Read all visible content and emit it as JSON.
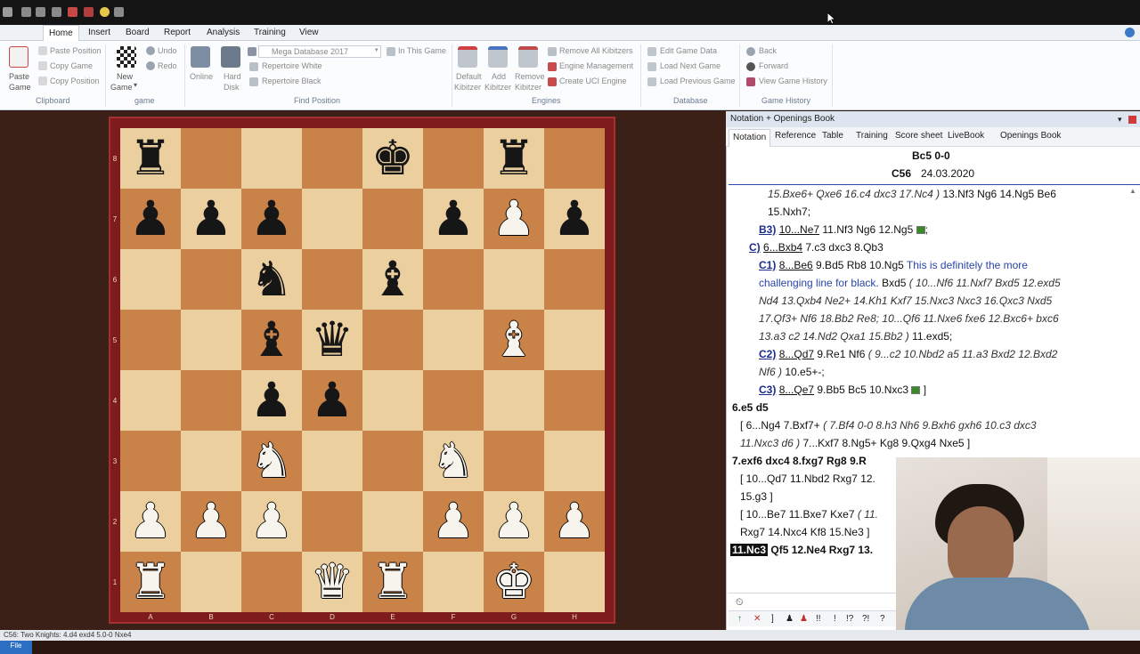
{
  "ribbon": {
    "tabs": [
      "File",
      "Home",
      "Insert",
      "Board",
      "Report",
      "Analysis",
      "Training",
      "View"
    ],
    "active_tab": "Home",
    "clipboard": {
      "paste_game": "Paste\nGame",
      "paste_game_1": "Paste",
      "paste_game_2": "Game",
      "paste_position": "Paste Position",
      "copy_game": "Copy Game",
      "copy_position": "Copy Position",
      "group": "Clipboard"
    },
    "game": {
      "new_game_1": "New",
      "new_game_2": "Game",
      "undo": "Undo",
      "redo": "Redo",
      "group": "game"
    },
    "find_position": {
      "online": "Online",
      "hard_disk_1": "Hard",
      "hard_disk_2": "Disk",
      "database": "Mega Database 2017",
      "in_this_game": "In This Game",
      "repertoire_white": "Repertoire White",
      "repertoire_black": "Repertoire Black",
      "group": "Find Position"
    },
    "engines": {
      "default_kibitzer_1": "Default",
      "default_kibitzer_2": "Kibitzer",
      "add_kibitzer_1": "Add",
      "add_kibitzer_2": "Kibitzer",
      "remove_kibitzer_1": "Remove",
      "remove_kibitzer_2": "Kibitzer",
      "remove_all": "Remove All Kibitzers",
      "engine_management": "Engine Management",
      "create_uci": "Create UCI Engine",
      "group": "Engines"
    },
    "database": {
      "edit_game_data": "Edit Game Data",
      "load_next_game": "Load Next Game",
      "load_previous_game": "Load Previous Game",
      "group": "Database"
    },
    "game_history": {
      "back": "Back",
      "forward": "Forward",
      "view_history": "View Game History",
      "group": "Game History"
    }
  },
  "board": {
    "ranks": [
      "8",
      "7",
      "6",
      "5",
      "4",
      "3",
      "2",
      "1"
    ],
    "files": [
      "A",
      "B",
      "C",
      "D",
      "E",
      "F",
      "G",
      "H"
    ],
    "position": [
      [
        "br",
        "",
        "",
        "",
        "bk",
        "",
        "br",
        ""
      ],
      [
        "bp",
        "bp",
        "bp",
        "",
        "",
        "bp",
        "wp",
        "bp"
      ],
      [
        "",
        "",
        "bn",
        "",
        "bb",
        "",
        "",
        ""
      ],
      [
        "",
        "",
        "bb",
        "bq",
        "",
        "",
        "wb",
        ""
      ],
      [
        "",
        "",
        "bp",
        "bp",
        "",
        "",
        "",
        ""
      ],
      [
        "",
        "",
        "wn",
        "",
        "",
        "wn",
        "",
        ""
      ],
      [
        "wp",
        "wp",
        "wp",
        "",
        "",
        "wp",
        "wp",
        "wp"
      ],
      [
        "wr",
        "",
        "",
        "wq",
        "wr",
        "",
        "wk",
        ""
      ]
    ]
  },
  "panel": {
    "title": "Notation + Openings Book",
    "tabs": [
      "Notation",
      "Reference",
      "Table",
      "Training",
      "Score sheet",
      "LiveBook",
      "Openings Book"
    ],
    "active_tab": "Notation",
    "line_title": "Bc5 0-0",
    "eco": "C56",
    "date": "24.03.2020",
    "notation": {
      "l1a": "15.Bxe6+  Qxe6  16.c4  dxc3  17.Nc4 )",
      "l1b": " 13.Nf3  Ng6  14.Ng5  Be6",
      "l2": "15.Nxh7;",
      "b3_label": "B3)",
      "b3_move": "10...Ne7",
      "b3_rest": "  11.Nf3  Ng6  12.Ng5",
      "b3_end": ";",
      "c_label": "C)",
      "c_move": "6...Bxb4",
      "c_rest": "  7.c3  dxc3  8.Qb3",
      "c1_label": "C1)",
      "c1_move": "8...Be6",
      "c1_rest": "  9.Bd5  Rb8  10.Ng5 ",
      "c1_comment_a": "This is definitely the more",
      "c1_comment_b": "challenging line for black.",
      "c1_tail": " Bxd5 ",
      "c1_var_a": "( 10...Nf6  11.Nxf7  Bxd5  12.exd5",
      "c1_var_b": "Nd4  13.Qxb4  Ne2+  14.Kh1  Kxf7  15.Nxc3  Nxc3  16.Qxc3  Nxd5",
      "c1_var_c": "17.Qf3+  Nf6  18.Bb2  Re8;  10...Qf6  11.Nxe6  fxe6  12.Bxc6+  bxc6",
      "c1_var_d": "13.a3  c2  14.Nd2  Qxa1  15.Bb2 )",
      "c1_var_d_tail": " 11.exd5;",
      "c2_label": "C2)",
      "c2_move": "8...Qd7",
      "c2_rest": "  9.Re1  Nf6 ",
      "c2_var": "( 9...c2  10.Nbd2  a5  11.a3  Bxd2  12.Bxd2",
      "c2_var2": "Nf6 )",
      "c2_tail": " 10.e5+-;",
      "c3_label": "C3)",
      "c3_move": "8...Qe7",
      "c3_rest": "  9.Bb5  Bc5  10.Nxc3",
      "c3_end": " ]",
      "main1": "6.e5  d5",
      "side1a": "[ 6...Ng4  7.Bxf7+ ",
      "side1b": "( 7.Bf4  0-0  8.h3  Nh6  9.Bxh6  gxh6  10.c3  dxc3",
      "side1c": "11.Nxc3  d6 )",
      "side1d": " 7...Kxf7  8.Ng5+  Kg8  9.Qxg4  Nxe5 ]",
      "main2": "7.exf6  dxc4  8.fxg7  Rg8  9.R",
      "side2a": "[ 10...Qd7  11.Nbd2  Rxg7  12.",
      "side2b": "15.g3 ]",
      "side3a": "[ 10...Be7  11.Bxe7  Kxe7 ",
      "side3a_it": "( 11.",
      "side3b": "Rxg7  14.Nxc4  Kf8  15.Ne3 ]",
      "current_move": "11.Nc3",
      "after_current": "  Qf5  12.Ne4  Rxg7  13."
    },
    "symbols": [
      "↑",
      "✕",
      "]",
      "♟",
      "♟",
      "!!",
      "!",
      "!?",
      "?!",
      "?"
    ]
  },
  "status": "C56: Two Knights: 4.d4 exd4 5.0-0 Nxe4"
}
